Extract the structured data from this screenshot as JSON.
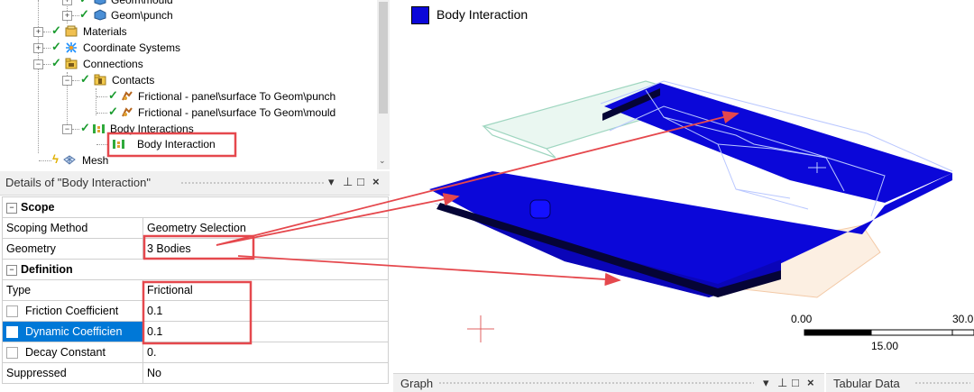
{
  "tree": {
    "items": [
      {
        "label": "Geom\\mould"
      },
      {
        "label": "Geom\\punch"
      },
      {
        "label": "Materials"
      },
      {
        "label": "Coordinate Systems"
      },
      {
        "label": "Connections"
      },
      {
        "label": "Contacts"
      },
      {
        "label": "Frictional - panel\\surface To Geom\\punch"
      },
      {
        "label": "Frictional - panel\\surface To Geom\\mould"
      },
      {
        "label": "Body Interactions"
      },
      {
        "label": "Body Interaction"
      },
      {
        "label": "Mesh"
      }
    ]
  },
  "details": {
    "title": "Details of \"Body Interaction\"",
    "controls": {
      "dropdown": "▾",
      "pin": "⊥",
      "maximize": "□",
      "close": "×"
    },
    "sections": {
      "scope": "Scope",
      "definition": "Definition"
    },
    "rows": {
      "scoping_method": {
        "name": "Scoping Method",
        "value": "Geometry Selection"
      },
      "geometry": {
        "name": "Geometry",
        "value": "3 Bodies"
      },
      "type": {
        "name": "Type",
        "value": "Frictional"
      },
      "friction": {
        "name": "Friction Coefficient",
        "value": "0.1"
      },
      "dynamic": {
        "name": "Dynamic Coefficien",
        "value": "0.1"
      },
      "decay": {
        "name": "Decay Constant",
        "value": "0."
      },
      "suppressed": {
        "name": "Suppressed",
        "value": "No"
      }
    },
    "collapse_symbol": "−"
  },
  "viewport": {
    "legend": {
      "label": "Body Interaction",
      "color": "#0b07d9"
    },
    "scale": {
      "zero": "0.00",
      "mid": "15.00",
      "max": "30.0"
    }
  },
  "graph": {
    "title": "Graph"
  },
  "tabular": {
    "title": "Tabular Data"
  },
  "colors": {
    "body_blue": "#0b07d9",
    "highlight_red": "#e5484d",
    "selection_blue": "#0078d7"
  }
}
